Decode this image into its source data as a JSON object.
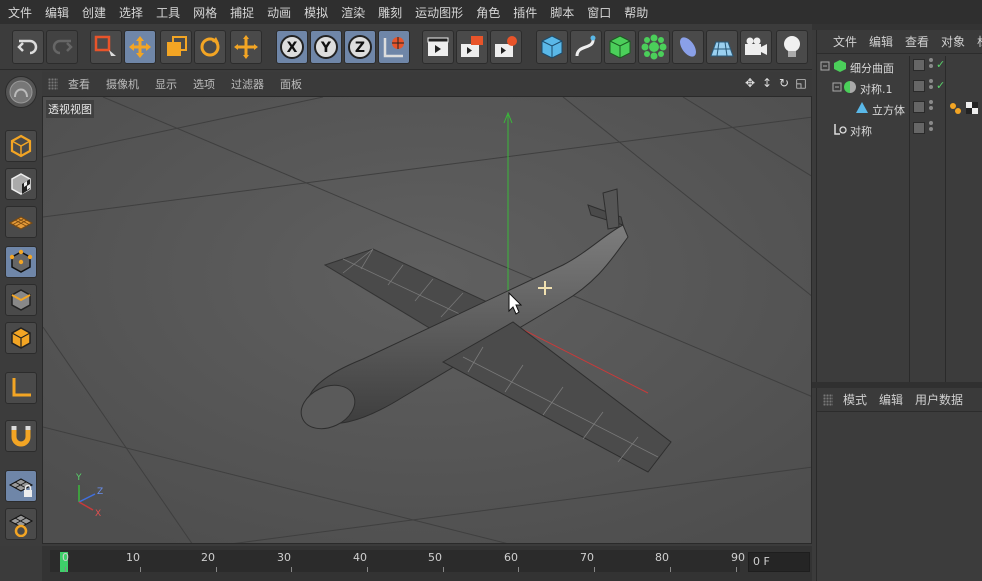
{
  "menu": [
    "文件",
    "编辑",
    "创建",
    "选择",
    "工具",
    "网格",
    "捕捉",
    "动画",
    "模拟",
    "渲染",
    "雕刻",
    "运动图形",
    "角色",
    "插件",
    "脚本",
    "窗口",
    "帮助"
  ],
  "toolbar_icons": [
    "undo-icon",
    "redo-icon",
    "live-select-icon",
    "move-icon",
    "scale-icon",
    "rotate-icon",
    "move-alt-icon",
    "x-axis-lock-icon",
    "y-axis-lock-icon",
    "z-axis-lock-icon",
    "world-coordinates-icon",
    "render-view-icon",
    "render-picture-viewer-icon",
    "render-settings-icon",
    "cube-primitive-icon",
    "spline-pen-icon",
    "subdivision-surface-icon",
    "cloner-icon",
    "deformer-icon",
    "floor-icon",
    "camera-icon",
    "light-icon"
  ],
  "left_tools": [
    "make-editable-icon",
    "model-mode-icon",
    "texture-mode-icon",
    "workplane-mode-icon",
    "points-mode-icon",
    "edges-mode-icon",
    "polygons-mode-icon",
    "axis-mode-icon",
    "snap-magnet-icon",
    "lock-workplane-icon",
    "planar-workplane-icon"
  ],
  "viewport": {
    "menus": [
      "查看",
      "摄像机",
      "显示",
      "选项",
      "过滤器",
      "面板"
    ],
    "label": "透视视图",
    "axis_labels": {
      "x": "X",
      "y": "Y",
      "z": "Z"
    }
  },
  "timeline": {
    "ticks": [
      "0",
      "10",
      "20",
      "30",
      "40",
      "50",
      "60",
      "70",
      "80",
      "90"
    ],
    "current_frame": "0 F"
  },
  "object_manager": {
    "tabs": [
      "文件",
      "编辑",
      "查看",
      "对象",
      "标"
    ],
    "objects": [
      {
        "name": "细分曲面",
        "icon": "subdivision-surface-icon",
        "enabled": "✓"
      },
      {
        "name": "对称.1",
        "icon": "symmetry-icon",
        "enabled": "✓"
      },
      {
        "name": "立方体",
        "icon": "polygon-object-icon",
        "enabled": ""
      },
      {
        "name": "对称",
        "icon": "null-object-icon",
        "enabled": ""
      }
    ]
  },
  "attribute_manager": {
    "tabs": [
      "模式",
      "编辑",
      "用户数据"
    ]
  },
  "colors": {
    "active_button": "#6f86a8",
    "axis_x": "#d04040",
    "axis_y": "#40c040",
    "axis_z": "#4070e0",
    "frame_marker": "#3ed06a"
  }
}
